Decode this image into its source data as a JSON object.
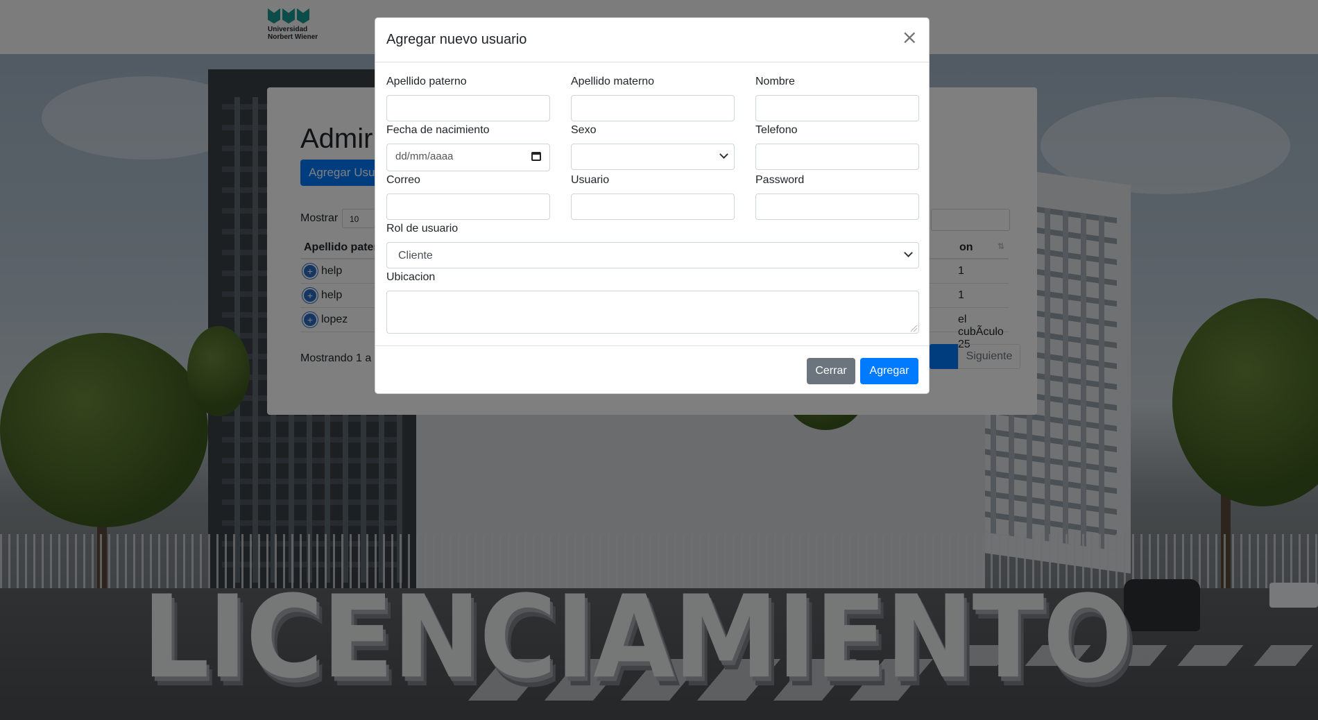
{
  "brand": {
    "line1": "Universidad",
    "line2": "Norbert Wiener"
  },
  "background": {
    "sign_text": "LICENCIAMIENTO"
  },
  "page": {
    "title": "Admir",
    "add_button_label": "Agregar Usua",
    "show_label": "Mostrar",
    "show_value": "10",
    "table": {
      "header_left": "Apellido pater",
      "header_right": "on",
      "header_sort": "⇅",
      "rows": [
        {
          "left": "help",
          "right": "1"
        },
        {
          "left": "help",
          "right": "1"
        },
        {
          "left": "lopez",
          "right": "el cubÃculo 25"
        }
      ]
    },
    "info_text": "Mostrando 1 a",
    "next_label": "Siguiente"
  },
  "modal": {
    "title": "Agregar nuevo usuario",
    "close_symbol": "×",
    "fields": {
      "apellido_paterno": "Apellido paterno",
      "apellido_materno": "Apellido materno",
      "nombre": "Nombre",
      "fecha_nacimiento": "Fecha de nacimiento",
      "fecha_placeholder": "dd/mm/aaaa",
      "sexo": "Sexo",
      "sexo_value": "",
      "telefono": "Telefono",
      "correo": "Correo",
      "usuario": "Usuario",
      "password": "Password",
      "rol": "Rol de usuario",
      "rol_value": "Cliente",
      "ubicacion": "Ubicacion"
    },
    "buttons": {
      "close": "Cerrar",
      "submit": "Agregar"
    }
  },
  "colors": {
    "primary": "#007bff",
    "secondary": "#6c757d",
    "brand_teal": "#1a9a93"
  }
}
